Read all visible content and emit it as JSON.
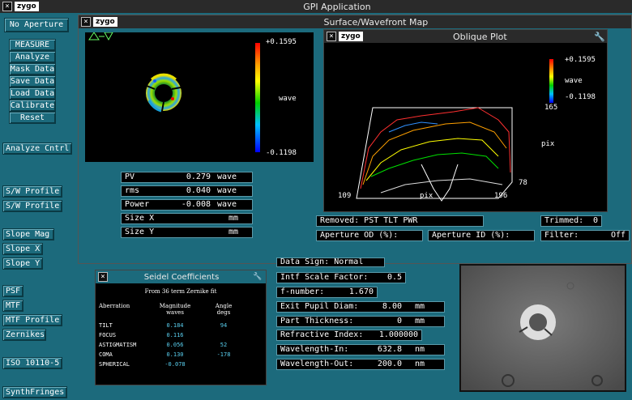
{
  "app": {
    "title": "GPI Application",
    "logo": "zygo"
  },
  "left": {
    "no_aperture": "No Aperture",
    "buttons": [
      "MEASURE",
      "Analyze",
      "Mask Data",
      "Save Data",
      "Load Data",
      "Calibrate",
      "Reset"
    ],
    "analyze_cntrl": "Analyze Cntrl",
    "sw1": "S/W Profile",
    "sw2": "S/W Profile",
    "slope_mag": "Slope Mag",
    "slope_x": "Slope X",
    "slope_y": "Slope Y",
    "psf": "PSF",
    "mtf": "MTF",
    "mtf_profile": "MTF Profile",
    "zernikes": "Zernikes",
    "iso": "ISO 10110-5",
    "synth": "SynthFringes"
  },
  "surface": {
    "title": "Surface/Wavefront Map",
    "logo": "zygo",
    "scale_max": "+0.1595",
    "scale_min": "-0.1198",
    "scale_unit": "wave",
    "stats": [
      {
        "label": "PV",
        "value": "0.279",
        "unit": "wave"
      },
      {
        "label": "rms",
        "value": "0.040",
        "unit": "wave"
      },
      {
        "label": "Power",
        "value": "-0.008",
        "unit": "wave"
      },
      {
        "label": "Size X",
        "value": "",
        "unit": "mm"
      },
      {
        "label": "Size Y",
        "value": "",
        "unit": "mm"
      }
    ],
    "removed": "Removed: PST TLT PWR",
    "trimmed_label": "Trimmed:",
    "trimmed_value": "0",
    "aperture_od": "Aperture OD (%):",
    "aperture_id": "Aperture ID (%):",
    "filter_label": "Filter:",
    "filter_value": "Off"
  },
  "oblique": {
    "title": "Oblique Plot",
    "logo": "zygo",
    "scale_max": "+0.1595",
    "scale_unit": "wave",
    "scale_min": "-0.1198",
    "axis_165": "165",
    "axis_pix_y": "pix",
    "axis_78": "78",
    "axis_109": "109",
    "axis_pix_x": "pix",
    "axis_196": "196"
  },
  "seidel": {
    "title": "Seidel Coefficients",
    "subtitle": "From 36 term Zernike fit",
    "headers": {
      "aberration": "Aberration",
      "magnitude": "Magnitude",
      "magnitude_unit": "waves",
      "angle": "Angle",
      "angle_unit": "degs"
    },
    "rows": [
      {
        "name": "TILT",
        "mag": "0.184",
        "angle": "94"
      },
      {
        "name": "FOCUS",
        "mag": "0.116",
        "angle": ""
      },
      {
        "name": "ASTIGMATISM",
        "mag": "0.056",
        "angle": "52"
      },
      {
        "name": "COMA",
        "mag": "0.130",
        "angle": "-178"
      },
      {
        "name": "SPHERICAL",
        "mag": "-0.078",
        "angle": ""
      }
    ]
  },
  "params": {
    "data_sign": "Data Sign:   Normal",
    "intf_scale": {
      "label": "Intf Scale Factor:",
      "value": "0.5"
    },
    "fnumber": {
      "label": "f-number:",
      "value": "1.670"
    },
    "exit_pupil": {
      "label": "Exit Pupil Diam:",
      "value": "8.00",
      "unit": "mm"
    },
    "part_thickness": {
      "label": "Part Thickness:",
      "value": "0",
      "unit": "mm"
    },
    "refractive": {
      "label": "Refractive Index:",
      "value": "1.000000"
    },
    "wl_in": {
      "label": "Wavelength-In:",
      "value": "632.8",
      "unit": "nm"
    },
    "wl_out": {
      "label": "Wavelength-Out:",
      "value": "200.0",
      "unit": "nm"
    }
  }
}
